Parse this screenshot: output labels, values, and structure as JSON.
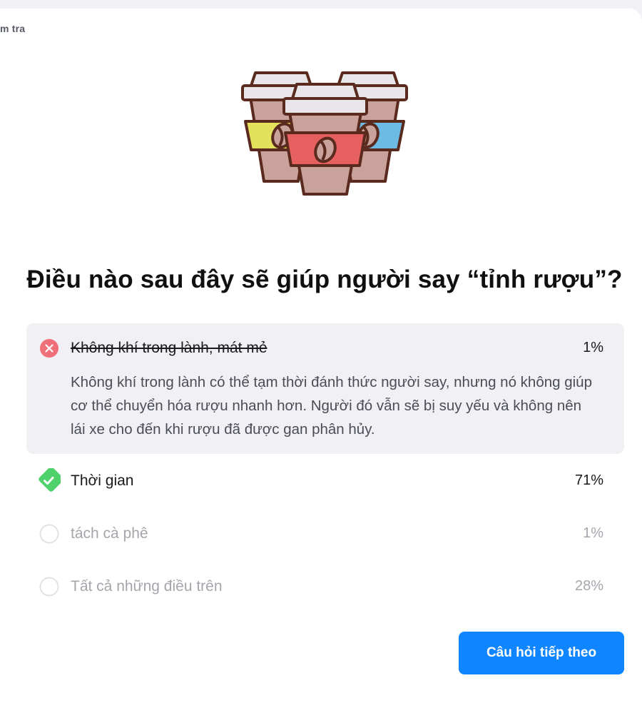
{
  "breadcrumb": {
    "text": "m tra"
  },
  "illustration": {
    "icon": "coffee-cups-icon"
  },
  "question": {
    "text": "Điều nào sau đây sẽ giúp người say “tỉnh rượu”?"
  },
  "options": [
    {
      "label": "Không khí trong lành, mát mẻ",
      "percent": "1%",
      "state": "incorrect",
      "explanation": "Không khí trong lành có thể tạm thời đánh thức người say, nhưng nó không giúp cơ thể chuyển hóa rượu nhanh hơn. Người đó vẫn sẽ bị suy yếu và không nên lái xe cho đến khi rượu đã được gan phân hủy."
    },
    {
      "label": "Thời gian",
      "percent": "71%",
      "state": "correct"
    },
    {
      "label": "tách cà phê",
      "percent": "1%",
      "state": "unselected"
    },
    {
      "label": "Tất cả những điều trên",
      "percent": "28%",
      "state": "unselected"
    }
  ],
  "actions": {
    "next_label": "Câu hỏi tiếp theo"
  },
  "colors": {
    "accent": "#0f85ff",
    "incorrect": "#f0707a",
    "correct": "#4fd26b",
    "muted": "#a5a6ac"
  }
}
